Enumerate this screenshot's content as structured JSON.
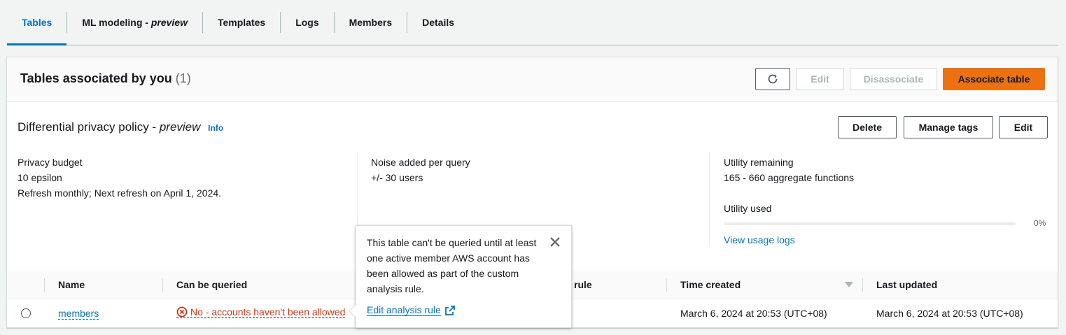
{
  "tabs": [
    {
      "label": "Tables",
      "active": true
    },
    {
      "label": "ML modeling - ",
      "em": "preview"
    },
    {
      "label": "Templates"
    },
    {
      "label": "Logs"
    },
    {
      "label": "Members"
    },
    {
      "label": "Details"
    }
  ],
  "container": {
    "title": "Tables associated by you",
    "count": "(1)",
    "buttons": {
      "refresh_icon": "refresh-icon",
      "edit": "Edit",
      "disassociate": "Disassociate",
      "associate": "Associate table"
    }
  },
  "policy": {
    "title": "Differential privacy policy - ",
    "title_em": "preview",
    "info": "Info",
    "buttons": {
      "delete": "Delete",
      "manage_tags": "Manage tags",
      "edit": "Edit"
    },
    "privacy_budget": {
      "label": "Privacy budget",
      "value": "10 epsilon",
      "refresh": "Refresh monthly; Next refresh on April 1, 2024."
    },
    "noise": {
      "label": "Noise added per query",
      "value": "+/- 30 users"
    },
    "utility": {
      "label": "Utility remaining",
      "value": "165 - 660 aggregate functions",
      "used_label": "Utility used",
      "used_pct": "0%",
      "used_fraction": 0,
      "view_logs": "View usage logs"
    }
  },
  "table": {
    "columns": [
      "Name",
      "Can be queried",
      "rule",
      "Time created",
      "Last updated"
    ],
    "rows": [
      {
        "name": "members",
        "can_be_queried": "No - accounts haven't been allowed",
        "time_created": "March 6, 2024 at 20:53 (UTC+08)",
        "last_updated": "March 6, 2024 at 20:53 (UTC+08)"
      }
    ]
  },
  "popover": {
    "text": "This table can't be queried until at least one active member AWS account has been allowed as part of the custom analysis rule.",
    "link": "Edit analysis rule",
    "close_icon": "close-icon",
    "external_icon": "external-link-icon"
  },
  "colors": {
    "accent": "#0073bb",
    "primary_button": "#ec7211",
    "error": "#d13212"
  }
}
